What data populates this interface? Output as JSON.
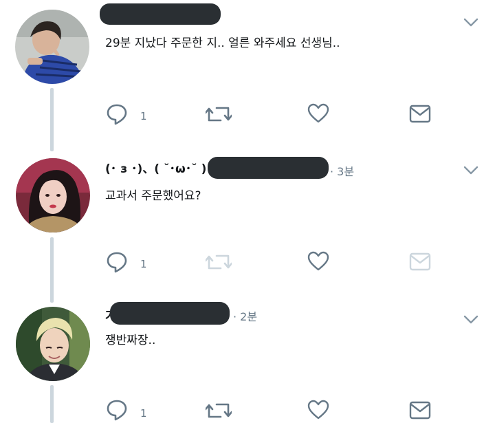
{
  "tweets": [
    {
      "text": "29분 지났다 주문한 지.. 얼른 와주세요 선생님..",
      "reply_count": "1"
    },
    {
      "name_prefix": "(･ з ･)、( ˘･ω･˘ ) ╯",
      "time": "· 3분",
      "text": "교과서 주문했어요?",
      "reply_count": "1"
    },
    {
      "name_prefix": "가",
      "time": "· 2분",
      "text": "쟁반짜장..",
      "reply_count": "1"
    }
  ],
  "icons": {
    "reply": "reply-icon",
    "retweet": "retweet-icon",
    "like": "heart-icon",
    "dm": "mail-icon",
    "menu": "chevron-down-icon"
  },
  "colors": {
    "icon": "#657786",
    "icon_disabled": "#ccd6dd",
    "thread_line": "#ccd6dd",
    "redaction": "#2a2f33"
  }
}
